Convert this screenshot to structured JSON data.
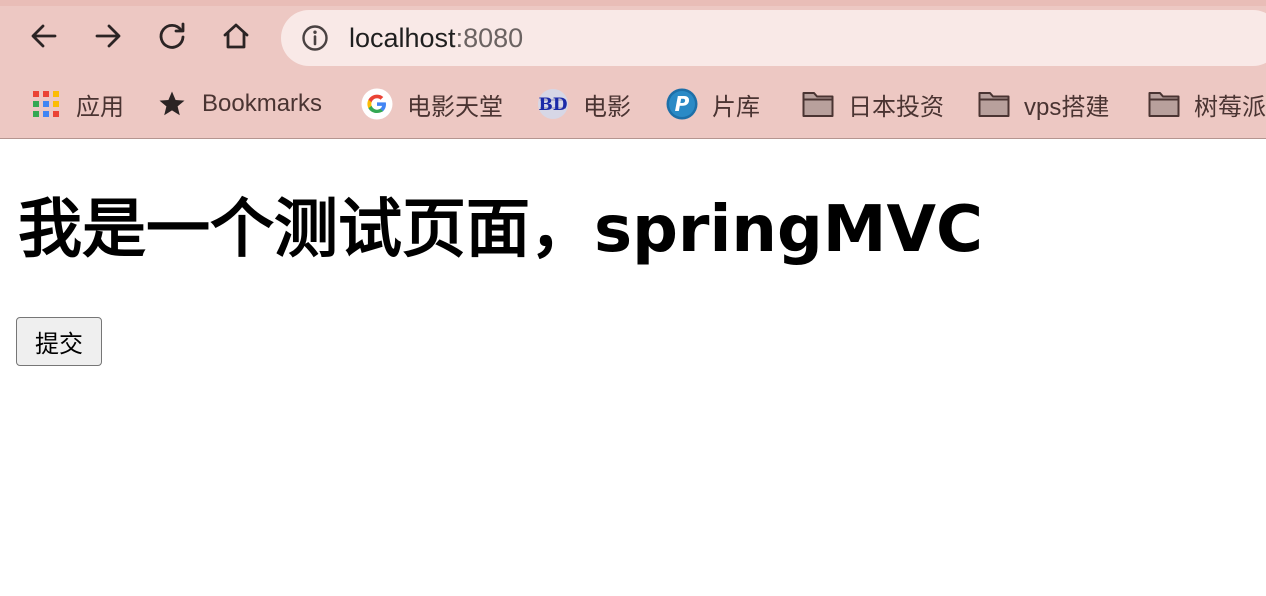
{
  "browser": {
    "address_bar": {
      "host": "localhost",
      "port": ":8080"
    },
    "nav": {
      "back_icon": "arrow-left-icon",
      "forward_icon": "arrow-right-icon",
      "reload_icon": "reload-icon",
      "home_icon": "home-icon",
      "info_icon": "info-icon"
    },
    "bookmarks": [
      {
        "label": "应用",
        "icon": "apps-grid-icon"
      },
      {
        "label": "Bookmarks",
        "icon": "star-icon"
      },
      {
        "label": "电影天堂",
        "icon": "google-icon"
      },
      {
        "label": "电影",
        "icon": "bd-icon"
      },
      {
        "label": "片库",
        "icon": "p-icon"
      },
      {
        "label": "日本投资",
        "icon": "folder-icon"
      },
      {
        "label": "vps搭建",
        "icon": "folder-icon"
      },
      {
        "label": "树莓派",
        "icon": "folder-icon"
      }
    ],
    "colors": {
      "chrome_bg": "#edc8c3",
      "omnibox_bg": "#f9e9e7"
    }
  },
  "page": {
    "title": "我是一个测试页面，springMVC",
    "submit_label": "提交"
  }
}
